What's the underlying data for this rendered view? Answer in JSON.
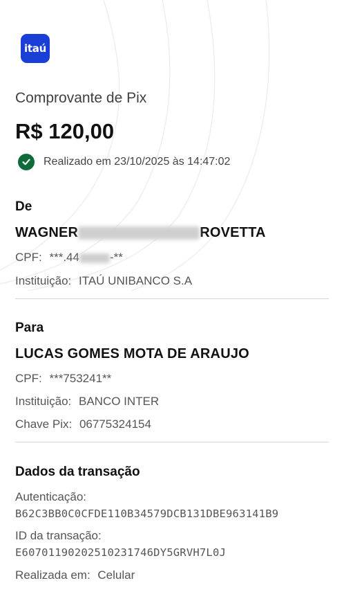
{
  "brand": {
    "logo_text": "itaú",
    "color": "#1a3fd6"
  },
  "header": {
    "title": "Comprovante de Pix",
    "amount": "R$ 120,00",
    "status": "Realizado em 23/10/2025 às 14:47:02",
    "status_color": "#0f6b3a"
  },
  "from": {
    "section": "De",
    "name_first": "WAGNER",
    "name_last": "ROVETTA",
    "cpf_label": "CPF:",
    "cpf_prefix": "***.44",
    "cpf_suffix": "-**",
    "institution_label": "Instituição:",
    "institution": "ITAÚ UNIBANCO S.A"
  },
  "to": {
    "section": "Para",
    "name": "LUCAS GOMES MOTA DE ARAUJO",
    "cpf_label": "CPF:",
    "cpf": "***753241**",
    "institution_label": "Instituição:",
    "institution": "BANCO INTER",
    "pix_key_label": "Chave Pix:",
    "pix_key": "06775324154"
  },
  "transaction": {
    "section": "Dados da transação",
    "auth_label": "Autenticação:",
    "auth_value": "B62C3BB0C0CFDE110B34579DCB131DBE963141B9",
    "id_label": "ID da transação:",
    "id_value": "E60701190202510231746DY5GRVH7L0J",
    "channel_label": "Realizada em:",
    "channel": "Celular"
  }
}
